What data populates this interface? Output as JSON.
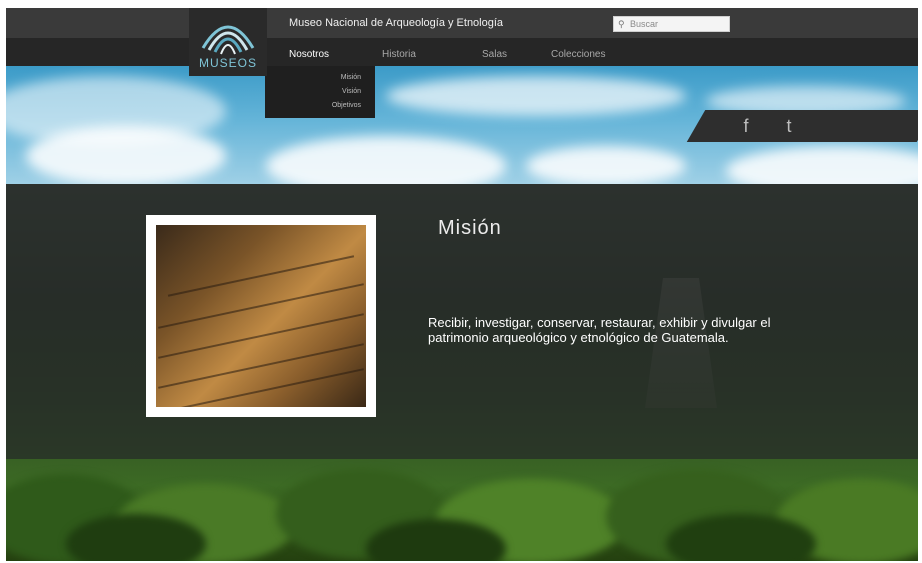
{
  "header": {
    "site_title": "Museo Nacional de Arqueología y Etnología",
    "logo_text": "MUSEOS",
    "logo_subtext": "",
    "search_placeholder": "Buscar"
  },
  "nav": {
    "items": [
      {
        "label": "Nosotros",
        "active": true
      },
      {
        "label": "Historia",
        "active": false
      },
      {
        "label": "Salas",
        "active": false
      },
      {
        "label": "Colecciones",
        "active": false
      }
    ],
    "dropdown": [
      "Misión",
      "Visión",
      "Objetivos"
    ]
  },
  "social": {
    "facebook": "f",
    "twitter": "t"
  },
  "mission": {
    "title": "Misión",
    "text": "Recibir, investigar, conservar, restaurar, exhibir y divulgar el patrimonio arqueológico y etnológico de Guatemala."
  },
  "colors": {
    "accent": "#7fc4d6",
    "header": "#3a3a3a",
    "nav": "#262626"
  },
  "icons": [
    "museum-logo-icon",
    "search-icon",
    "facebook-icon",
    "twitter-icon"
  ]
}
